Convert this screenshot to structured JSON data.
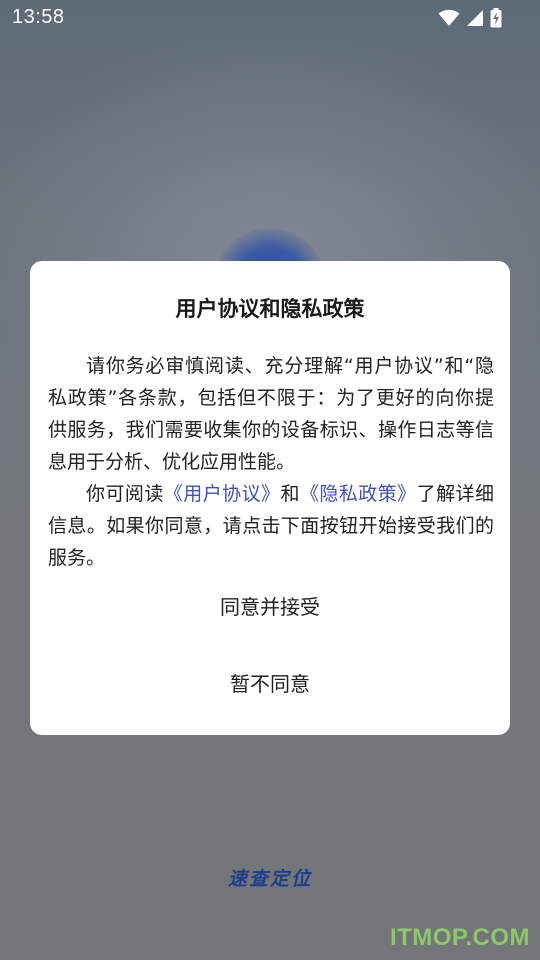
{
  "status_bar": {
    "time": "13:58",
    "icons": [
      "wifi-icon",
      "cellular-signal-icon",
      "battery-charging-icon"
    ]
  },
  "dialog": {
    "title": "用户协议和隐私政策",
    "paragraph1": "请你务必审慎阅读、充分理解“用户协议”和“隐私政策”各条款，包括但不限于：为了更好的向你提供服务，我们需要收集你的设备标识、操作日志等信息用于分析、优化应用性能。",
    "paragraph2_prefix": "你可阅读",
    "user_agreement_link": "《用户协议》",
    "paragraph2_and": "和",
    "privacy_policy_link": "《隐私政策》",
    "paragraph2_suffix": "了解详细信息。如果你同意，请点击下面按钮开始接受我们的服务。",
    "agree_button": "同意并接受",
    "disagree_button": "暂不同意"
  },
  "app": {
    "logo_text": "速查定位"
  },
  "watermark": "ITMOP.COM",
  "colors": {
    "link": "#3f51b5",
    "logo": "#1f3f8c",
    "watermark": "#8fd16a"
  }
}
